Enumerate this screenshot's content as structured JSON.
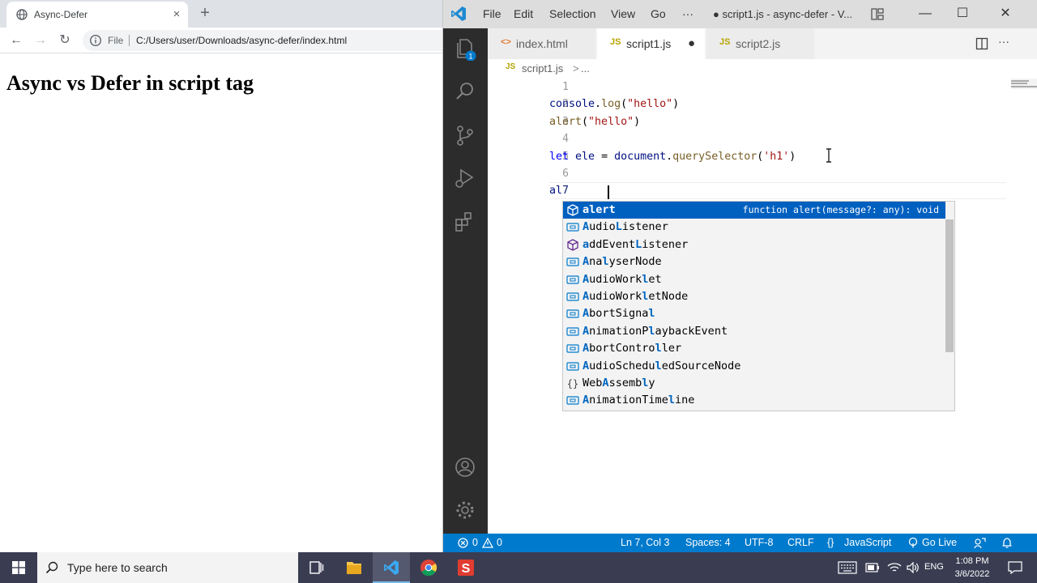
{
  "browser": {
    "tab_title": "Async-Defer",
    "close_glyph": "×",
    "newtab_glyph": "+",
    "back_glyph": "←",
    "forward_glyph": "→",
    "reload_glyph": "↻",
    "scheme_label": "File",
    "url": "C:/Users/user/Downloads/async-defer/index.html",
    "page_heading": "Async vs Defer in script tag"
  },
  "vscode": {
    "menu": [
      "File",
      "Edit",
      "Selection",
      "View",
      "Go",
      "···"
    ],
    "window_title": "● script1.js - async-defer - V...",
    "win_controls": {
      "minimize": "—",
      "maximize": "☐",
      "close": "✕"
    },
    "explorer_badge": "1",
    "tabs": [
      {
        "icon": "<>",
        "label": "index.html"
      },
      {
        "icon": "JS",
        "label": "script1.js",
        "dirty": "●"
      },
      {
        "icon": "JS",
        "label": "script2.js"
      }
    ],
    "breadcrumb": {
      "icon": "JS",
      "file": "script1.js",
      "rest": "...",
      "chevron": ">"
    },
    "line_numbers": [
      "1",
      "2",
      "3",
      "4",
      "5",
      "6",
      "7"
    ],
    "code": {
      "l2_obj": "console",
      "l2_dot": ".",
      "l2_fn": "log",
      "l2_open": "(",
      "l2_str": "\"hello\"",
      "l2_close": ")",
      "l3_fn": "alert",
      "l3_open": "(",
      "l3_str": "\"hello\"",
      "l3_close": ")",
      "l5_kw": "let",
      "l5_var": " ele",
      "l5_eq": " = ",
      "l5_obj": "document",
      "l5_dot": ".",
      "l5_fn": "querySelector",
      "l5_open": "(",
      "l5_str": "'h1'",
      "l5_close": ")",
      "l7_typed": "al"
    },
    "suggestions": [
      {
        "label": "alert",
        "kind": "method",
        "detail": "function alert(message?: any): void"
      },
      {
        "label": "AudioListener",
        "kind": "variable"
      },
      {
        "label": "addEventListener",
        "kind": "method"
      },
      {
        "label": "AnalyserNode",
        "kind": "variable"
      },
      {
        "label": "AudioWorklet",
        "kind": "variable"
      },
      {
        "label": "AudioWorkletNode",
        "kind": "variable"
      },
      {
        "label": "AbortSignal",
        "kind": "variable"
      },
      {
        "label": "AnimationPlaybackEvent",
        "kind": "variable"
      },
      {
        "label": "AbortController",
        "kind": "variable"
      },
      {
        "label": "AudioScheduledSourceNode",
        "kind": "variable"
      },
      {
        "label": "WebAssembly",
        "kind": "module"
      },
      {
        "label": "AnimationTimeline",
        "kind": "variable"
      }
    ],
    "status": {
      "errors": "0",
      "warnings": "0",
      "position": "Ln 7, Col 3",
      "spaces": "Spaces: 4",
      "encoding": "UTF-8",
      "eol": "CRLF",
      "language": "JavaScript",
      "golive": "Go Live"
    }
  },
  "taskbar": {
    "search_placeholder": "Type here to search",
    "language": "ENG",
    "time": "1:08 PM",
    "date": "3/6/2022"
  },
  "colors": {
    "vscode_accent": "#007acc",
    "suggest_selected": "#0060c0",
    "taskbar": "#3a3d52"
  }
}
